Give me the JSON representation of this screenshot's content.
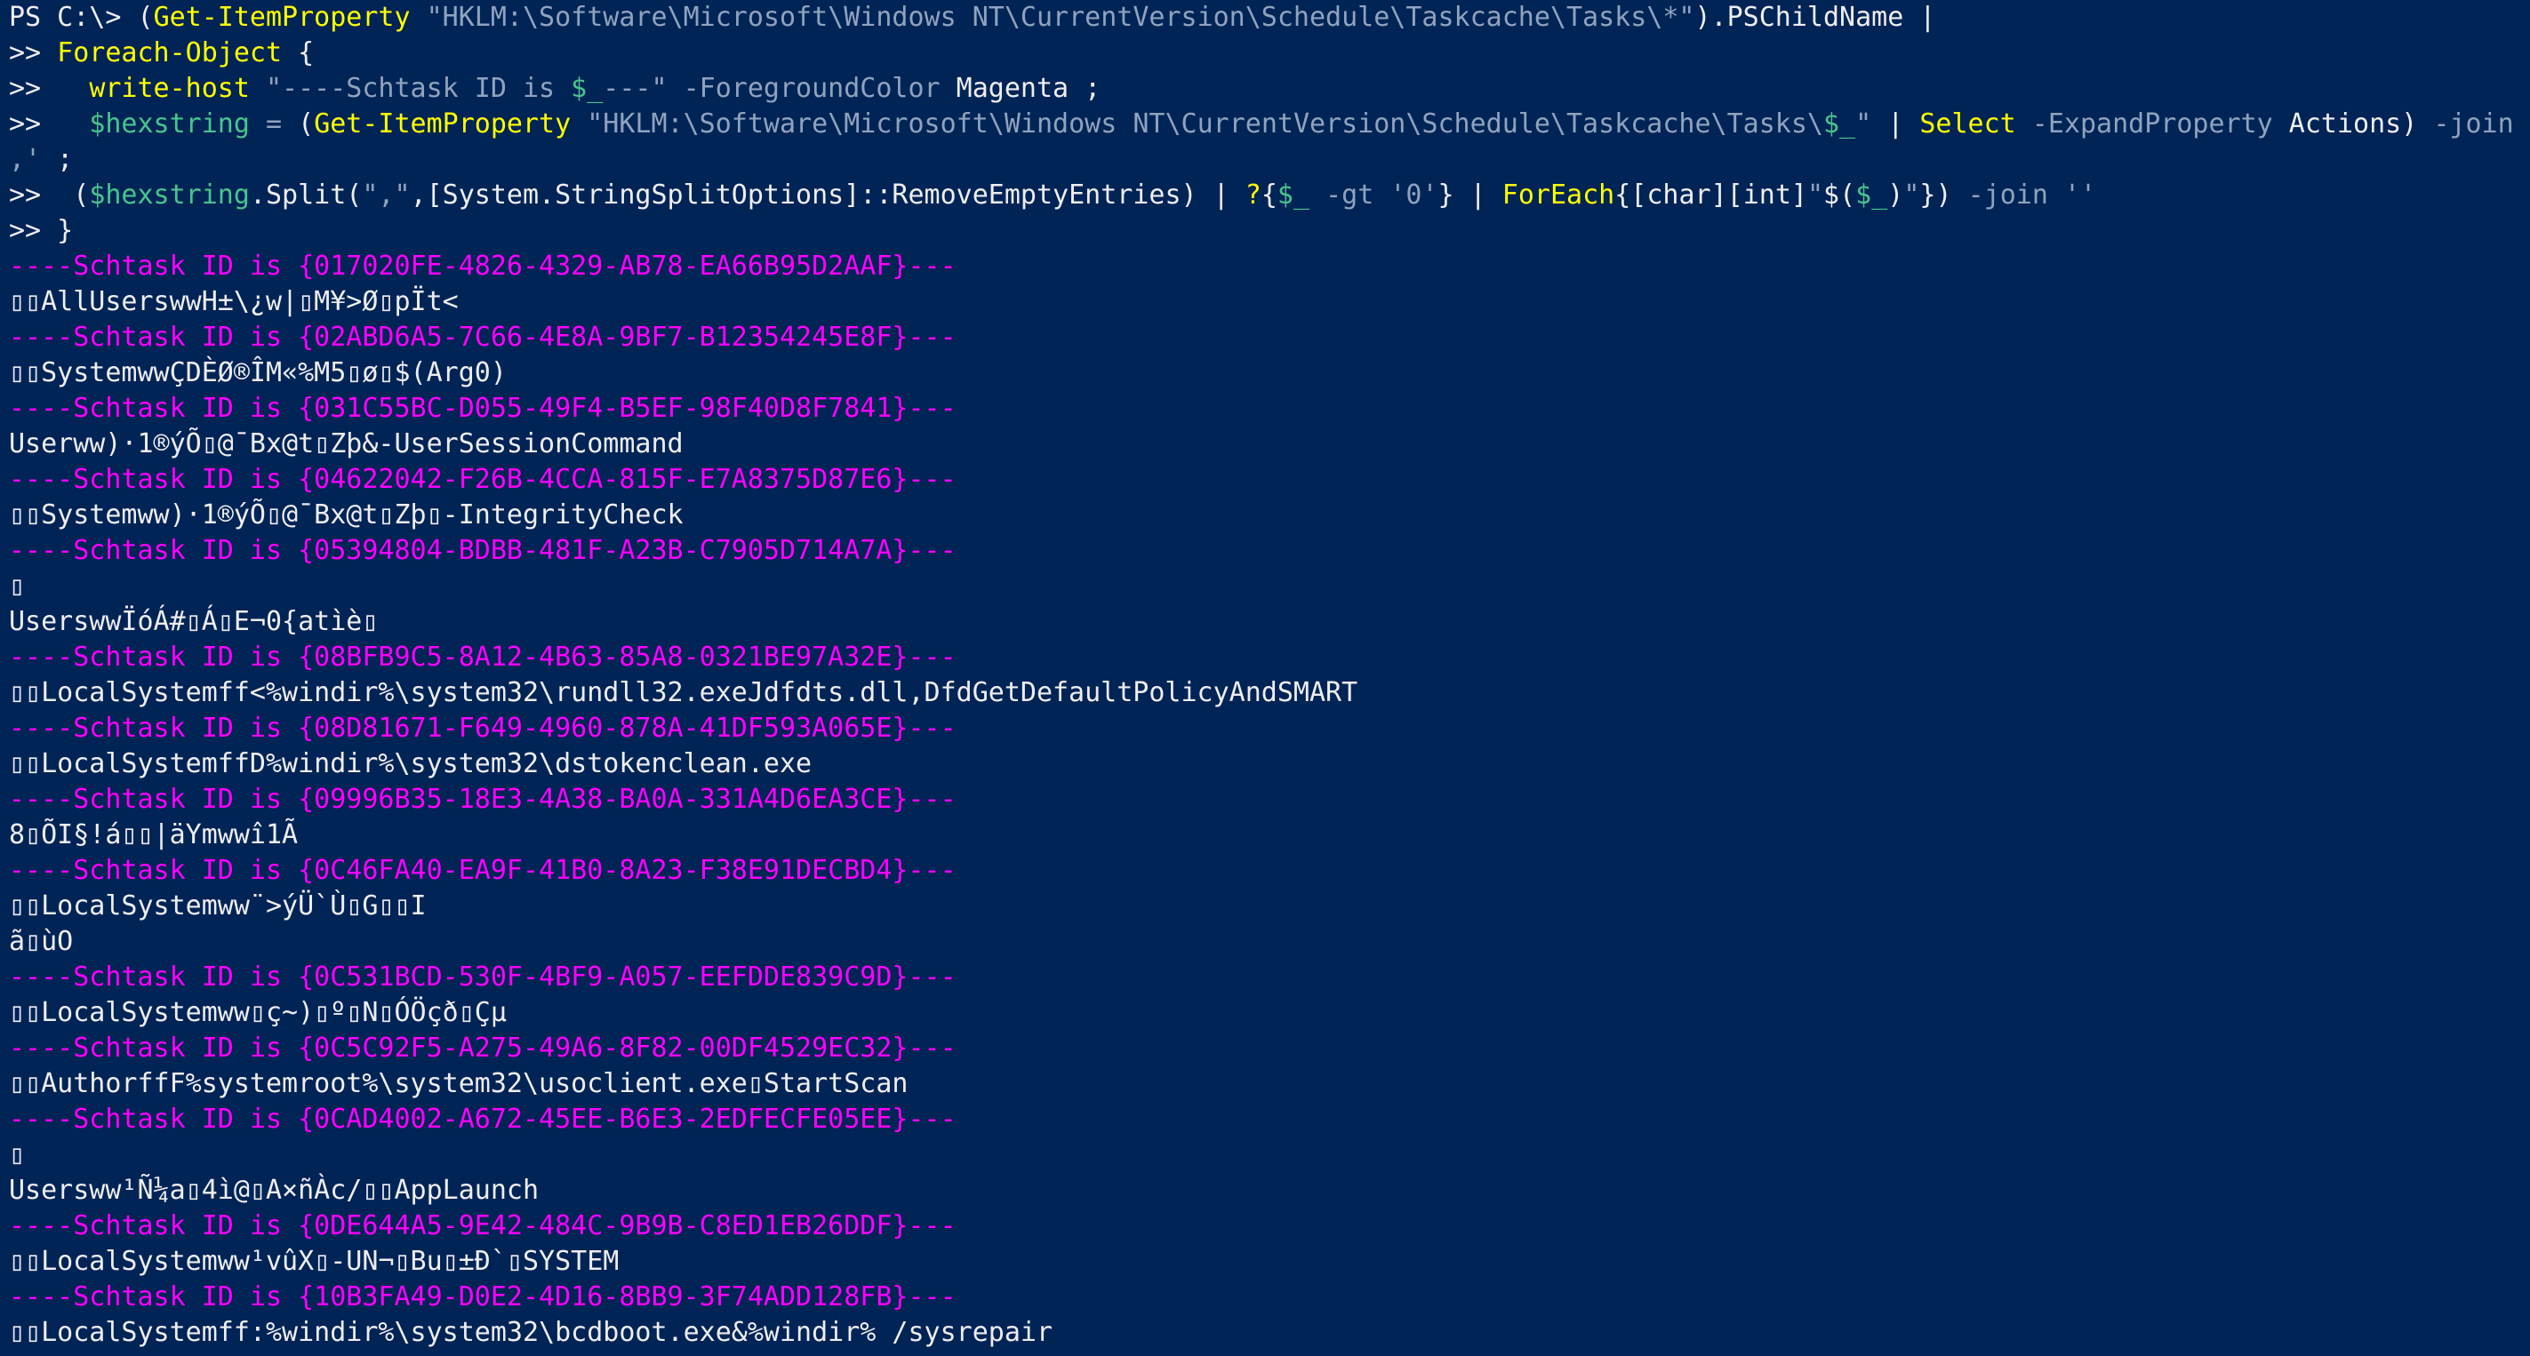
{
  "colors": {
    "background": "#012456",
    "text": "#EEEDF0",
    "command": "#FFFF00",
    "string": "#8FA3BE",
    "variable": "#48C48D",
    "header": "#FF00FF"
  },
  "command_lines": [
    {
      "name": "prompt-line-1",
      "tokens": [
        {
          "t": "PS C:\\> ",
          "c": "plain"
        },
        {
          "t": "(",
          "c": "plain"
        },
        {
          "t": "Get-ItemProperty",
          "c": "cmd"
        },
        {
          "t": " ",
          "c": "plain"
        },
        {
          "t": "\"HKLM:\\Software\\Microsoft\\Windows NT\\CurrentVersion\\Schedule\\Taskcache\\Tasks\\*\"",
          "c": "str"
        },
        {
          "t": ").PSChildName |",
          "c": "plain"
        }
      ]
    },
    {
      "name": "continuation-line-2",
      "tokens": [
        {
          "t": ">> ",
          "c": "plain"
        },
        {
          "t": "Foreach-Object",
          "c": "cmd"
        },
        {
          "t": " {",
          "c": "plain"
        }
      ]
    },
    {
      "name": "continuation-line-3",
      "tokens": [
        {
          "t": ">>   ",
          "c": "plain"
        },
        {
          "t": "write-host",
          "c": "cmd"
        },
        {
          "t": " ",
          "c": "plain"
        },
        {
          "t": "\"----Schtask ID is ",
          "c": "str"
        },
        {
          "t": "$_",
          "c": "var"
        },
        {
          "t": "---\"",
          "c": "str"
        },
        {
          "t": " ",
          "c": "plain"
        },
        {
          "t": "-ForegroundColor",
          "c": "param"
        },
        {
          "t": " Magenta ;",
          "c": "plain"
        }
      ]
    },
    {
      "name": "continuation-line-4",
      "tokens": [
        {
          "t": ">>   ",
          "c": "plain"
        },
        {
          "t": "$hexstring",
          "c": "var"
        },
        {
          "t": " ",
          "c": "plain"
        },
        {
          "t": "=",
          "c": "op"
        },
        {
          "t": " (",
          "c": "plain"
        },
        {
          "t": "Get-ItemProperty",
          "c": "cmd"
        },
        {
          "t": " ",
          "c": "plain"
        },
        {
          "t": "\"HKLM:\\Software\\Microsoft\\Windows NT\\CurrentVersion\\Schedule\\Taskcache\\Tasks\\",
          "c": "str"
        },
        {
          "t": "$_",
          "c": "var"
        },
        {
          "t": "\"",
          "c": "str"
        },
        {
          "t": " | ",
          "c": "plain"
        },
        {
          "t": "Select",
          "c": "cmd"
        },
        {
          "t": " ",
          "c": "plain"
        },
        {
          "t": "-ExpandProperty",
          "c": "param"
        },
        {
          "t": " Actions) ",
          "c": "plain"
        },
        {
          "t": "-join",
          "c": "param"
        },
        {
          "t": " '",
          "c": "str"
        }
      ]
    },
    {
      "name": "continuation-line-4-wrap",
      "tokens": [
        {
          "t": ",'",
          "c": "str"
        },
        {
          "t": " ;",
          "c": "plain"
        }
      ]
    },
    {
      "name": "continuation-line-5",
      "tokens": [
        {
          "t": ">>  (",
          "c": "plain"
        },
        {
          "t": "$hexstring",
          "c": "var"
        },
        {
          "t": ".Split(",
          "c": "plain"
        },
        {
          "t": "\",\"",
          "c": "str"
        },
        {
          "t": ",[System.StringSplitOptions]::RemoveEmptyEntries) | ",
          "c": "plain"
        },
        {
          "t": "?",
          "c": "cmd"
        },
        {
          "t": "{",
          "c": "plain"
        },
        {
          "t": "$_",
          "c": "var"
        },
        {
          "t": " ",
          "c": "plain"
        },
        {
          "t": "-gt",
          "c": "param"
        },
        {
          "t": " ",
          "c": "plain"
        },
        {
          "t": "'0'",
          "c": "str"
        },
        {
          "t": "} | ",
          "c": "plain"
        },
        {
          "t": "ForEach",
          "c": "cmd"
        },
        {
          "t": "{[char][int]",
          "c": "plain"
        },
        {
          "t": "\"",
          "c": "str"
        },
        {
          "t": "$(",
          "c": "plain"
        },
        {
          "t": "$_",
          "c": "var"
        },
        {
          "t": ")",
          "c": "plain"
        },
        {
          "t": "\"",
          "c": "str"
        },
        {
          "t": "}) ",
          "c": "plain"
        },
        {
          "t": "-join",
          "c": "param"
        },
        {
          "t": " ",
          "c": "plain"
        },
        {
          "t": "''",
          "c": "str"
        }
      ]
    },
    {
      "name": "continuation-line-6",
      "tokens": [
        {
          "t": ">> }",
          "c": "plain"
        }
      ]
    }
  ],
  "output_lines": [
    {
      "type": "header",
      "text": "----Schtask ID is {017020FE-4826-4329-AB78-EA66B95D2AAF}---"
    },
    {
      "type": "output",
      "text": "▯▯AllUserswwH±\\¿w|▯M¥>Ø▯pÏt<"
    },
    {
      "type": "header",
      "text": "----Schtask ID is {02ABD6A5-7C66-4E8A-9BF7-B12354245E8F}---"
    },
    {
      "type": "output",
      "text": "▯▯SystemwwÇDÈØ®ÎM«%M5▯ø▯$(Arg0)"
    },
    {
      "type": "header",
      "text": "----Schtask ID is {031C55BC-D055-49F4-B5EF-98F40D8F7841}---"
    },
    {
      "type": "output",
      "text": "Userww)·1®ýÕ▯@¯Bx@t▯Zþ&-UserSessionCommand"
    },
    {
      "type": "header",
      "text": "----Schtask ID is {04622042-F26B-4CCA-815F-E7A8375D87E6}---"
    },
    {
      "type": "output",
      "text": "▯▯Systemww)·1®ýÕ▯@¯Bx@t▯Zþ▯-IntegrityCheck"
    },
    {
      "type": "header",
      "text": "----Schtask ID is {05394804-BDBB-481F-A23B-C7905D714A7A}---"
    },
    {
      "type": "output",
      "text": "▯"
    },
    {
      "type": "output",
      "text": "UserswwÏóÁ#▯Á▯E¬0{atìè▯"
    },
    {
      "type": "header",
      "text": "----Schtask ID is {08BFB9C5-8A12-4B63-85A8-0321BE97A32E}---"
    },
    {
      "type": "output",
      "text": "▯▯LocalSystemff<%windir%\\system32\\rundll32.exeJdfdts.dll,DfdGetDefaultPolicyAndSMART"
    },
    {
      "type": "header",
      "text": "----Schtask ID is {08D81671-F649-4960-878A-41DF593A065E}---"
    },
    {
      "type": "output",
      "text": "▯▯LocalSystemffD%windir%\\system32\\dstokenclean.exe"
    },
    {
      "type": "header",
      "text": "----Schtask ID is {09996B35-18E3-4A38-BA0A-331A4D6EA3CE}---"
    },
    {
      "type": "output",
      "text": "8▯ÕI§!á▯▯|äYmwwî1Ã"
    },
    {
      "type": "header",
      "text": "----Schtask ID is {0C46FA40-EA9F-41B0-8A23-F38E91DECBD4}---"
    },
    {
      "type": "output",
      "text": "▯▯LocalSystemww¨>ýÜ`Ù▯G▯▯I"
    },
    {
      "type": "output",
      "text": "ã▯ùO"
    },
    {
      "type": "header",
      "text": "----Schtask ID is {0C531BCD-530F-4BF9-A057-EEFDDE839C9D}---"
    },
    {
      "type": "output",
      "text": "▯▯LocalSystemww▯ç~)▯º▯N▯ÓÖçð▯Çµ"
    },
    {
      "type": "header",
      "text": "----Schtask ID is {0C5C92F5-A275-49A6-8F82-00DF4529EC32}---"
    },
    {
      "type": "output",
      "text": "▯▯AuthorffF%systemroot%\\system32\\usoclient.exe▯StartScan"
    },
    {
      "type": "header",
      "text": "----Schtask ID is {0CAD4002-A672-45EE-B6E3-2EDFECFE05EE}---"
    },
    {
      "type": "output",
      "text": "▯"
    },
    {
      "type": "output",
      "text": "Usersww¹Ñ¼a▯4ì@▯A×ñÀc/▯▯AppLaunch"
    },
    {
      "type": "header",
      "text": "----Schtask ID is {0DE644A5-9E42-484C-9B9B-C8ED1EB26DDF}---"
    },
    {
      "type": "output",
      "text": "▯▯LocalSystemww¹vûX▯-UN¬▯Bu▯±Ð`▯SYSTEM"
    },
    {
      "type": "header",
      "text": "----Schtask ID is {10B3FA49-D0E2-4D16-8BB9-3F74ADD128FB}---"
    },
    {
      "type": "output",
      "text": "▯▯LocalSystemff:%windir%\\system32\\bcdboot.exe&%windir% /sysrepair"
    }
  ]
}
